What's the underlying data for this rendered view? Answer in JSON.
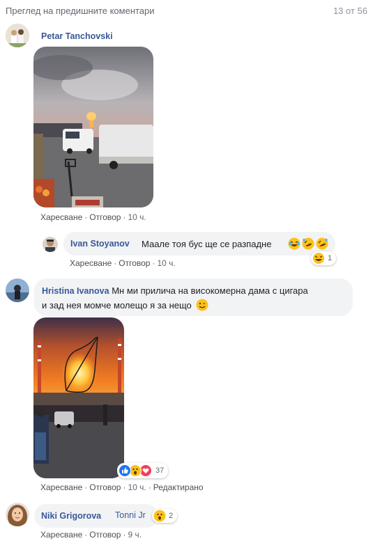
{
  "header": {
    "prev_comments": "Преглед на предишните коментари",
    "counter": "13 от 56"
  },
  "actions": {
    "like": "Харесване",
    "reply": "Отговор",
    "edited": "Редактирано"
  },
  "comments": [
    {
      "author": "Petar Tanchovski",
      "time": "10 ч."
    },
    {
      "author": "Ivan Stoyanov",
      "text": "Маале тоя бус ще се разпадне",
      "reaction_count": "1",
      "time": "10 ч."
    },
    {
      "author": "Hristina Ivanova",
      "text_line1": "Мн ми прилича на високомерна дама с цигара",
      "text_line2": "и зад нея момче молещо я за нещо",
      "reaction_count": "37",
      "time": "10 ч."
    },
    {
      "author": "Niki Grigorova",
      "mention": "Tonni Jr",
      "reaction_count": "2",
      "time": "9 ч."
    }
  ],
  "colors": {
    "name_link": "#385898",
    "bubble": "#f2f3f5",
    "meta": "#606770"
  }
}
